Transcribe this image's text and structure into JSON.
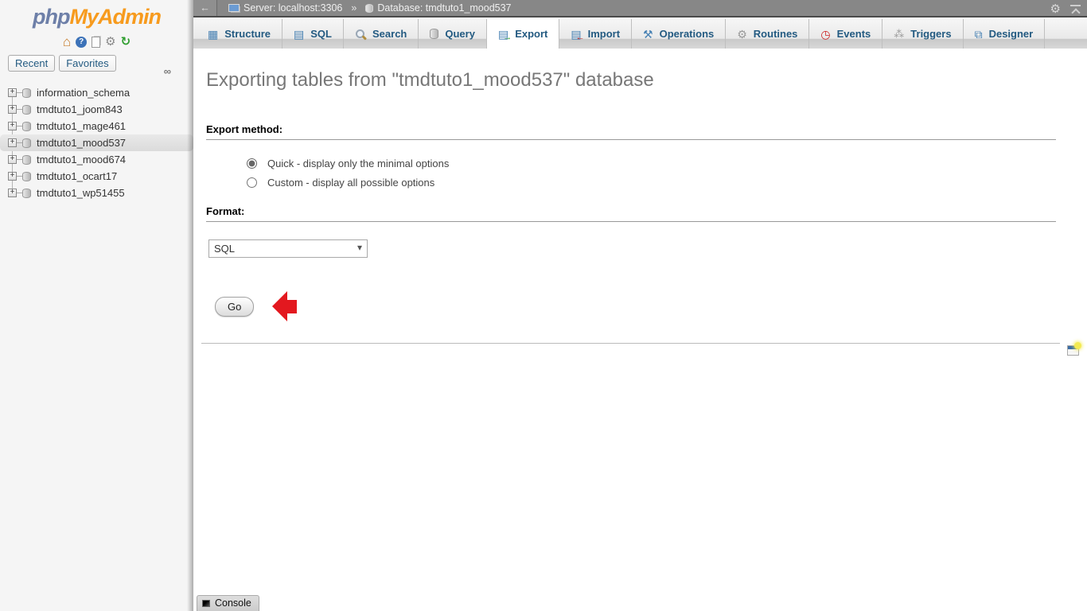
{
  "logo": {
    "php": "php",
    "myadmin": "MyAdmin"
  },
  "sidebar": {
    "recent_label": "Recent",
    "favorites_label": "Favorites",
    "databases": [
      "information_schema",
      "tmdtuto1_joom843",
      "tmdtuto1_mage461",
      "tmdtuto1_mood537",
      "tmdtuto1_mood674",
      "tmdtuto1_ocart17",
      "tmdtuto1_wp51455"
    ],
    "selected_database": "tmdtuto1_mood537"
  },
  "breadcrumb": {
    "back_glyph": "←",
    "server": "Server: localhost:3306",
    "separator": "»",
    "database": "Database: tmdtuto1_mood537"
  },
  "tabs": [
    {
      "label": "Structure",
      "icon": "structure-icon"
    },
    {
      "label": "SQL",
      "icon": "sql-icon"
    },
    {
      "label": "Search",
      "icon": "search-icon"
    },
    {
      "label": "Query",
      "icon": "query-icon"
    },
    {
      "label": "Export",
      "icon": "export-icon",
      "active": true
    },
    {
      "label": "Import",
      "icon": "import-icon"
    },
    {
      "label": "Operations",
      "icon": "operations-icon"
    },
    {
      "label": "Routines",
      "icon": "routines-icon"
    },
    {
      "label": "Events",
      "icon": "events-icon"
    },
    {
      "label": "Triggers",
      "icon": "triggers-icon"
    },
    {
      "label": "Designer",
      "icon": "designer-icon"
    }
  ],
  "main": {
    "heading": "Exporting tables from \"tmdtuto1_mood537\" database",
    "export_method_label": "Export method:",
    "quick_option": "Quick - display only the minimal options",
    "custom_option": "Custom - display all possible options",
    "format_label": "Format:",
    "format_value": "SQL",
    "go_label": "Go"
  },
  "console_label": "Console",
  "colors": {
    "logo_blue": "#6d7fa8",
    "logo_orange": "#f79b1e",
    "tab_text_blue": "#235a81",
    "topbar_gray": "#878787",
    "annotation_red": "#e3181f"
  }
}
